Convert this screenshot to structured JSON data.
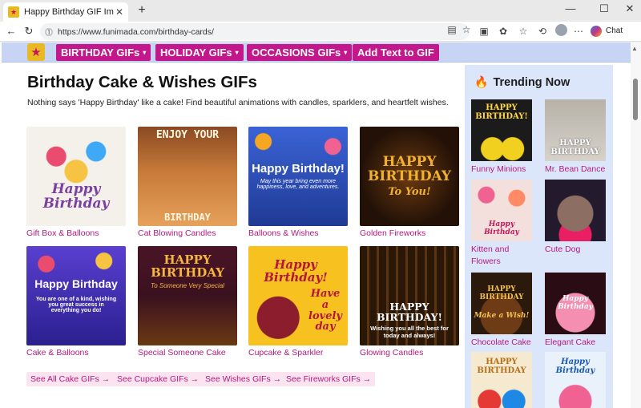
{
  "browser": {
    "tab_title": "Happy Birthday GIF Images - Dow",
    "url": "https://www.funimada.com/birthday-cards/",
    "chat_label": "Chat"
  },
  "nav": {
    "menu": [
      {
        "label": "BIRTHDAY GIFs",
        "caret": "▾"
      },
      {
        "label": "HOLIDAY GIFs",
        "caret": "▾"
      },
      {
        "label": "OCCASIONS GIFs",
        "caret": "▾"
      },
      {
        "label": "Add Text to GIF",
        "caret": ""
      }
    ]
  },
  "main": {
    "title": "Birthday Cake & Wishes GIFs",
    "intro": "Nothing says 'Happy Birthday' like a cake! Find beautiful animations with candles, sparklers, and heartfelt wishes.",
    "cards": [
      {
        "caption": "Gift Box & Balloons",
        "img_text": "Happy Birthday",
        "bg": "#f4f1ea",
        "fg": "#7b3fa0"
      },
      {
        "caption": "Cat Blowing Candles",
        "img_text": "ENJOY YOUR",
        "img_text2": "BIRTHDAY",
        "bg": "#c77a3a",
        "fg": "#fff6e0"
      },
      {
        "caption": "Balloons & Wishes",
        "img_text": "Happy Birthday!",
        "img_text2": "May this year bring even more happiness, love, and adventures.",
        "bg": "#2d4fb8",
        "fg": "#ffffff"
      },
      {
        "caption": "Golden Fireworks",
        "img_text": "HAPPY BIRTHDAY",
        "img_text2": "To You!",
        "bg": "#231107",
        "fg": "#f1b02e"
      },
      {
        "caption": "Cake & Balloons",
        "img_text": "Happy Birthday",
        "img_text2": "You are one of a kind, wishing you great success in everything you do!",
        "bg": "#3b2bb0",
        "fg": "#ffffff"
      },
      {
        "caption": "Special Someone Cake",
        "img_text": "HAPPY BIRTHDAY",
        "img_text2": "To Someone Very Special",
        "bg": "#3a1120",
        "fg": "#f5b640"
      },
      {
        "caption": "Cupcake & Sparkler",
        "img_text": "Happy Birthday!",
        "img_text2": "Have a lovely day",
        "bg": "#f7c21f",
        "fg": "#b5163f"
      },
      {
        "caption": "Glowing Candles",
        "img_text": "HAPPY BIRTHDAY!",
        "img_text2": "Wishing you all the best for today and always!",
        "bg": "#2a1706",
        "fg": "#ffffff"
      }
    ],
    "see_all": [
      "See All Cake GIFs →",
      "See Cupcake GIFs →",
      "See Wishes GIFs →",
      "See Fireworks GIFs →"
    ]
  },
  "sidebar": {
    "heading": "Trending Now",
    "items": [
      {
        "caption": "Funny Minions",
        "img_text": "HAPPY BIRTHDAY!",
        "bg": "#1b1b1b",
        "fg": "#ffd54a"
      },
      {
        "caption": "Mr. Bean Dance",
        "img_text": "HAPPY BIRTHDAY",
        "bg": "#c9c4bb",
        "fg": "#ffffff"
      },
      {
        "caption": "Kitten and Flowers",
        "img_text": "Happy Birthday",
        "bg": "#f3e0dc",
        "fg": "#c2185b"
      },
      {
        "caption": "Cute Dog",
        "img_text": "",
        "bg": "#241a2e",
        "fg": "#ffffff"
      },
      {
        "caption": "Chocolate Cake",
        "img_text": "HAPPY BIRTHDAY",
        "img_text2": "Make a Wish!",
        "bg": "#2b1a0c",
        "fg": "#f2c14e"
      },
      {
        "caption": "Elegant Cake",
        "img_text": "Happy Birthday",
        "bg": "#2a0d14",
        "fg": "#f7b7c7"
      },
      {
        "caption": "",
        "img_text": "HAPPY BIRTHDAY",
        "bg": "#f5e9d0",
        "fg": "#b5721a"
      },
      {
        "caption": "",
        "img_text": "Happy Birthday",
        "bg": "#e9f1fb",
        "fg": "#1a58b5"
      }
    ]
  },
  "colors": {
    "accent": "#c2188b",
    "link": "#b5197f",
    "header_bg": "#c8d4f4",
    "sidebar_bg": "#dce6fa"
  }
}
